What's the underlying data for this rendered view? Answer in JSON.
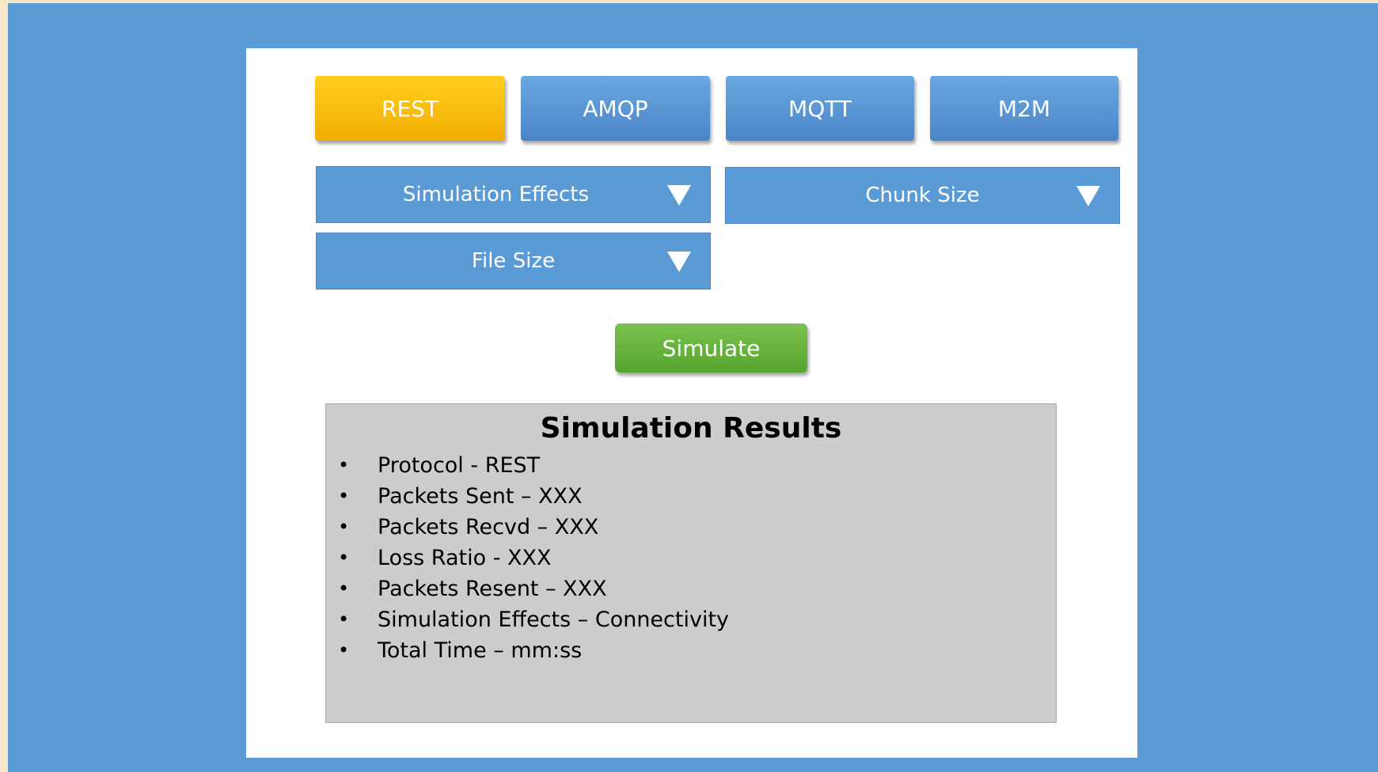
{
  "tabs": [
    {
      "label": "REST",
      "active": true
    },
    {
      "label": "AMQP",
      "active": false
    },
    {
      "label": "MQTT",
      "active": false
    },
    {
      "label": "M2M",
      "active": false
    }
  ],
  "dropdowns": {
    "simulation_effects": "Simulation Effects",
    "chunk_size": "Chunk Size",
    "file_size": "File Size"
  },
  "simulate_button": "Simulate",
  "results": {
    "title": "Simulation Results",
    "bullet": "•",
    "items": [
      "Protocol - REST",
      "Packets Sent – XXX",
      "Packets Recvd – XXX",
      "Loss Ratio - XXX",
      "Packets Resent – XXX",
      "Simulation Effects – Connectivity",
      "Total Time – mm:ss"
    ]
  },
  "colors": {
    "background": "#5b9bd5",
    "panel": "#ffffff",
    "active_tab": "#ffc000",
    "tab": "#5b9bd5",
    "simulate": "#70ad47",
    "results_box": "#cccccc"
  },
  "icons": {
    "dropdown_arrow": "triangle-down-icon"
  }
}
